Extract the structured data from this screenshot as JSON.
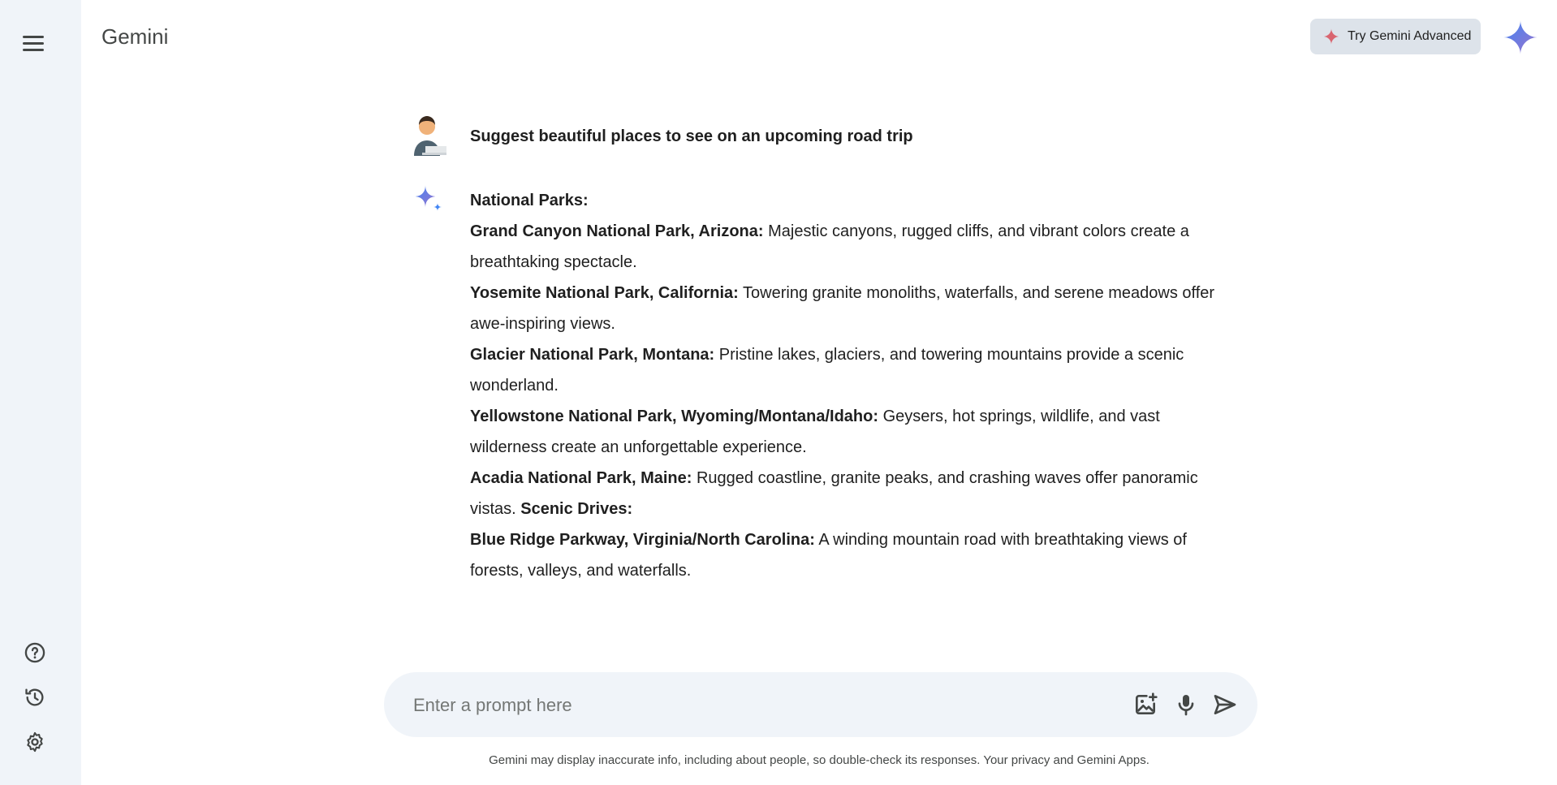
{
  "header": {
    "app_title": "Gemini",
    "try_button_label": "Try Gemini Advanced"
  },
  "sidebar": {
    "menu_icon": "hamburger-menu-icon",
    "bottom_items": [
      {
        "icon": "help-icon"
      },
      {
        "icon": "history-icon"
      },
      {
        "icon": "settings-gear-icon"
      }
    ]
  },
  "conversation": {
    "user_prompt": "Suggest beautiful places to see on an upcoming road trip",
    "response": {
      "section1": "National Parks:",
      "items": [
        {
          "title": "Grand Canyon National Park, Arizona:",
          "text": " Majestic canyons, rugged cliffs, and vibrant colors create a breathtaking spectacle."
        },
        {
          "title": "Yosemite National Park, California:",
          "text": " Towering granite monoliths, waterfalls, and serene meadows offer awe-inspiring views."
        },
        {
          "title": "Glacier National Park, Montana:",
          "text": " Pristine lakes, glaciers, and towering mountains provide a scenic wonderland."
        },
        {
          "title": "Yellowstone National Park, Wyoming/Montana/Idaho:",
          "text": " Geysers, hot springs, wildlife, and vast wilderness create an unforgettable experience."
        },
        {
          "title": "Acadia National Park, Maine:",
          "text": " Rugged coastline, granite peaks, and crashing waves offer panoramic vistas. "
        }
      ],
      "section2": "Scenic Drives:",
      "items2": [
        {
          "title": "Blue Ridge Parkway, Virginia/North Carolina:",
          "text": " A winding mountain road with breathtaking views of forests, valleys, and waterfalls."
        }
      ]
    }
  },
  "prompt": {
    "placeholder": "Enter a prompt here",
    "icons": [
      "add-image-icon",
      "microphone-icon",
      "send-icon"
    ]
  },
  "footer": {
    "disclaimer": "Gemini may display inaccurate info, including about people, so double-check its responses. Your privacy and Gemini Apps."
  },
  "colors": {
    "sidebar_bg": "#f0f4f9",
    "try_button_bg": "#dde3ea",
    "accent_blue": "#4285f4",
    "accent_red": "#d96570"
  }
}
